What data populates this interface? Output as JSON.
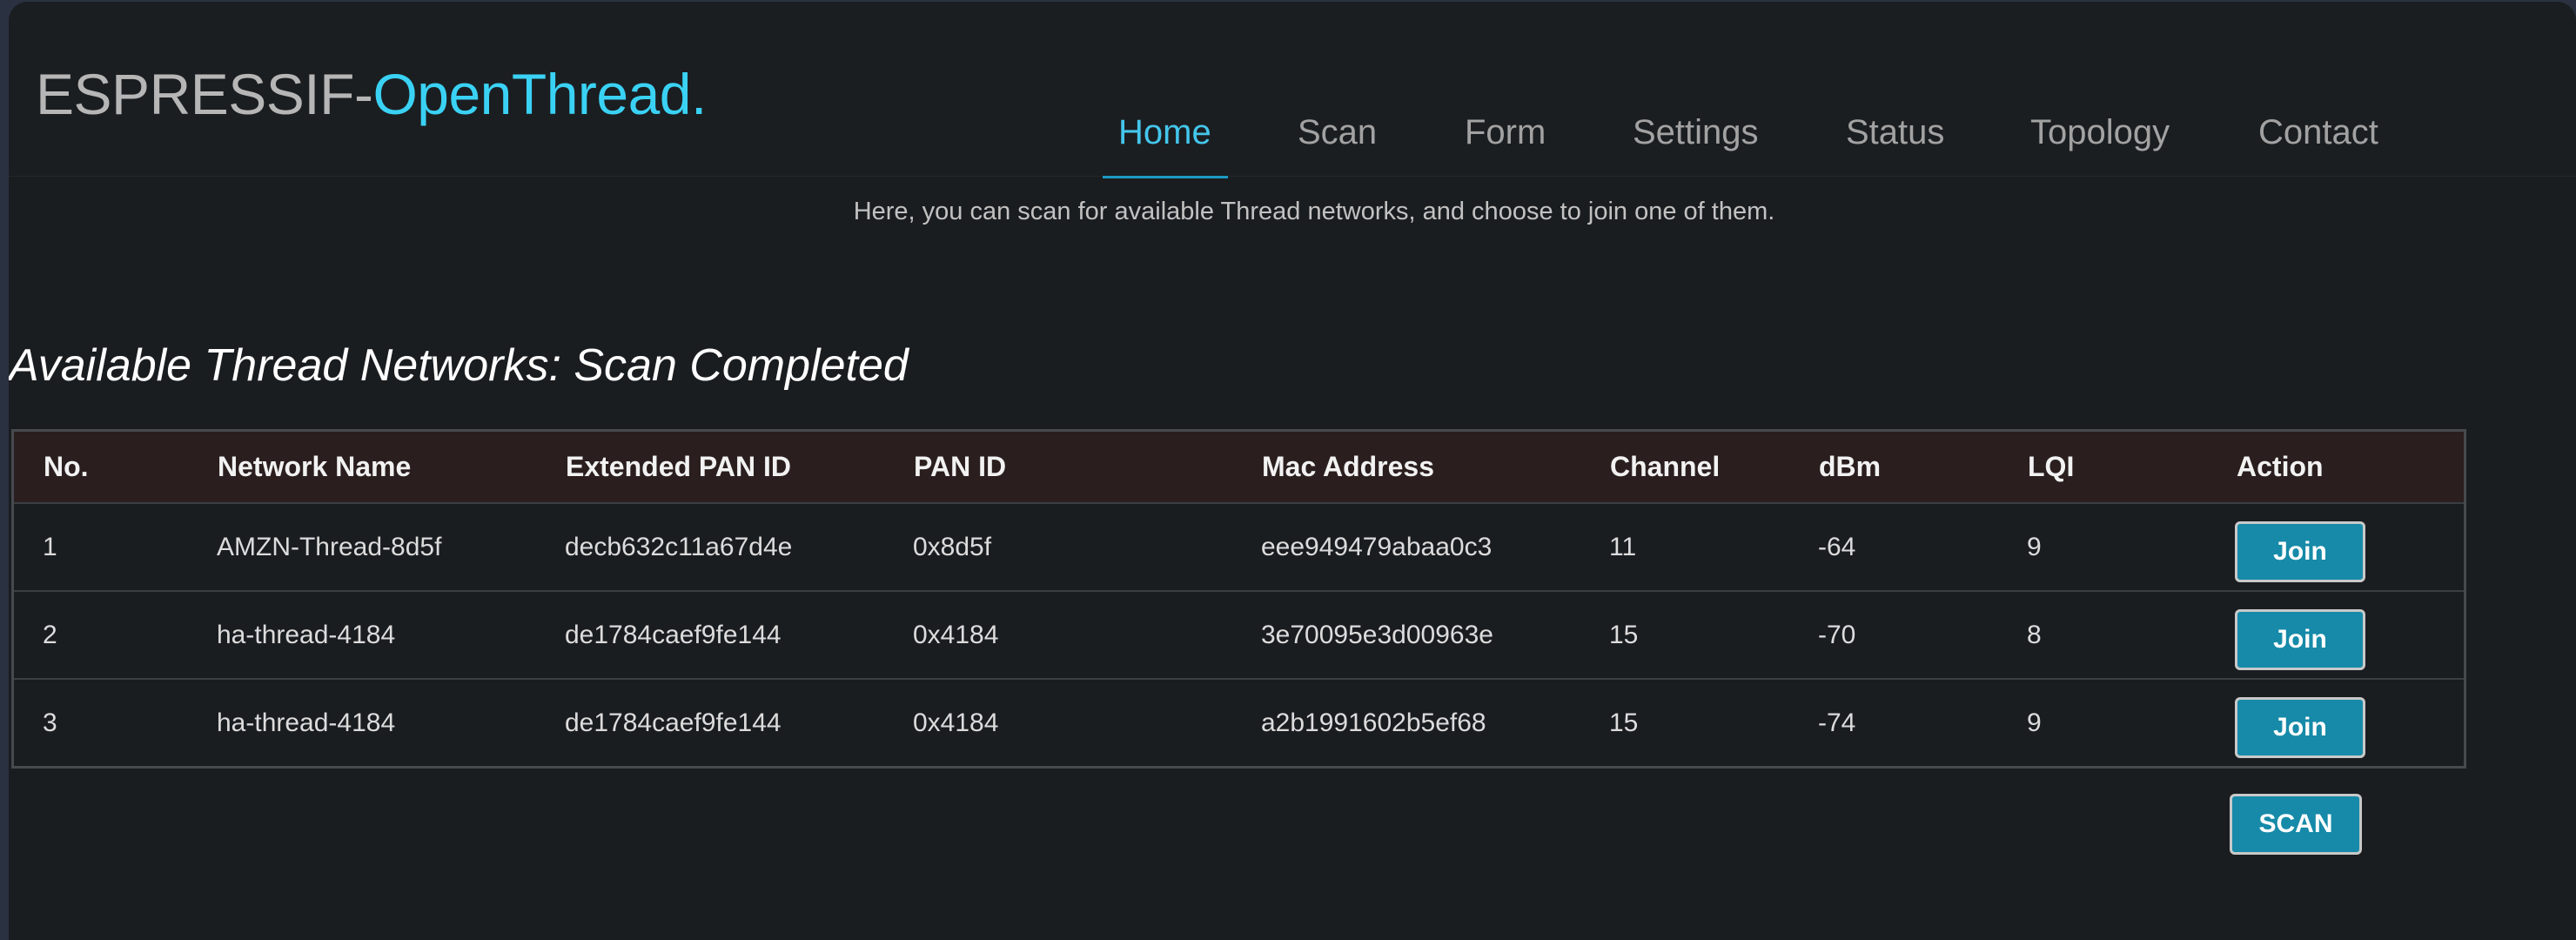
{
  "brand": {
    "prefix": "ESPRESSIF-",
    "highlight": "OpenThread."
  },
  "nav": {
    "items": [
      {
        "label": "Home",
        "active": true
      },
      {
        "label": "Scan",
        "active": false
      },
      {
        "label": "Form",
        "active": false
      },
      {
        "label": "Settings",
        "active": false
      },
      {
        "label": "Status",
        "active": false
      },
      {
        "label": "Topology",
        "active": false
      },
      {
        "label": "Contact",
        "active": false
      }
    ]
  },
  "subtitle": "Here, you can scan for available Thread networks, and choose to join one of them.",
  "section_title": "Available Thread Networks: Scan Completed",
  "table": {
    "headers": [
      "No.",
      "Network Name",
      "Extended PAN ID",
      "PAN ID",
      "Mac Address",
      "Channel",
      "dBm",
      "LQI",
      "Action"
    ],
    "rows": [
      {
        "no": "1",
        "network_name": "AMZN-Thread-8d5f",
        "ext_pan_id": "decb632c11a67d4e",
        "pan_id": "0x8d5f",
        "mac": "eee949479abaa0c3",
        "channel": "11",
        "dbm": "-64",
        "lqi": "9",
        "action": "Join"
      },
      {
        "no": "2",
        "network_name": "ha-thread-4184",
        "ext_pan_id": "de1784caef9fe144",
        "pan_id": "0x4184",
        "mac": "3e70095e3d00963e",
        "channel": "15",
        "dbm": "-70",
        "lqi": "8",
        "action": "Join"
      },
      {
        "no": "3",
        "network_name": "ha-thread-4184",
        "ext_pan_id": "de1784caef9fe144",
        "pan_id": "0x4184",
        "mac": "a2b1991602b5ef68",
        "channel": "15",
        "dbm": "-74",
        "lqi": "9",
        "action": "Join"
      }
    ]
  },
  "scan_button": "SCAN",
  "colors": {
    "accent": "#3ad2f4",
    "nav_active": "#44c6ec",
    "button": "#168aa8",
    "background": "#1a1d20",
    "table_header_bg": "#2a1f1e"
  }
}
